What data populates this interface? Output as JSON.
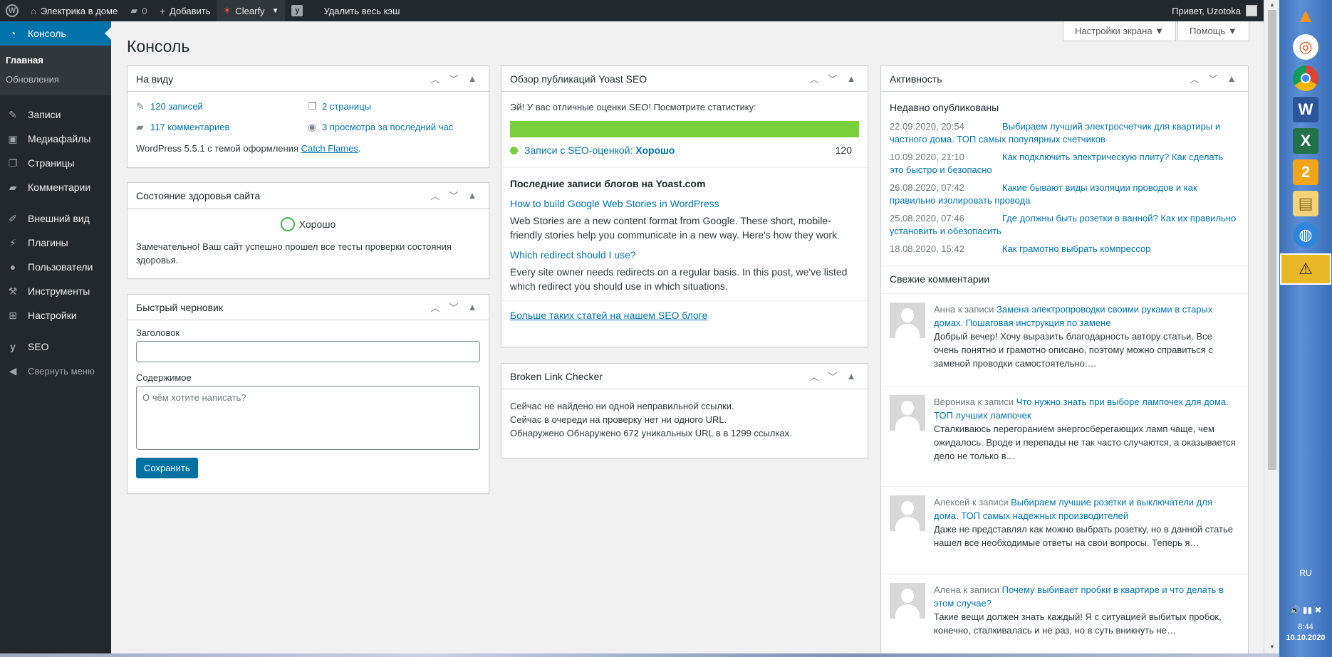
{
  "adminbar": {
    "site_name": "Электрика в доме",
    "comments_count": "0",
    "add_new": "Добавить",
    "clearfy": "Clearfy",
    "clear_cache": "Удалить весь кэш",
    "greeting": "Привет, Uzotoka"
  },
  "sidebar": {
    "dashboard": "Консоль",
    "home": "Главная",
    "updates": "Обновления",
    "posts": "Записи",
    "media": "Медиафайлы",
    "pages": "Страницы",
    "comments": "Комментарии",
    "appearance": "Внешний вид",
    "plugins": "Плагины",
    "users": "Пользователи",
    "tools": "Инструменты",
    "settings": "Настройки",
    "seo": "SEO",
    "collapse": "Свернуть меню"
  },
  "page": {
    "title": "Консоль",
    "screen_options": "Настройки экрана ▼",
    "help": "Помощь ▼"
  },
  "at_a_glance": {
    "title": "На виду",
    "posts": "120 записей",
    "pages": "2 страницы",
    "comments": "117 комментариев",
    "views": "3 просмотра за последний час",
    "version_text": "WordPress 5.5.1 с темой оформления ",
    "theme": "Catch Flames",
    "period": "."
  },
  "site_health": {
    "title": "Состояние здоровья сайта",
    "status": "Хорошо",
    "message": "Замечательно! Ваш сайт успешно прошел все тесты проверки состояния здоровья."
  },
  "quick_draft": {
    "title": "Быстрый черновик",
    "title_label": "Заголовок",
    "content_label": "Содержимое",
    "content_placeholder": "О чём хотите написать?",
    "save": "Сохранить"
  },
  "yoast": {
    "title": "Обзор публикаций Yoast SEO",
    "intro": "Эй! У вас отличные оценки SEO! Посмотрите статистику:",
    "score_label": "Записи с SEO-оценкой: ",
    "score_value": "Хорошо",
    "score_count": "120",
    "score_fraction": 1.0,
    "bar_color": "#7ad03a",
    "feed_title": "Последние записи блогов на Yoast.com",
    "feed": [
      {
        "title": "How to build Google Web Stories in WordPress",
        "desc": "Web Stories are a new content format from Google. These short, mobile-friendly stories help you communicate in a new way. Here's how they work"
      },
      {
        "title": "Which redirect should I use?",
        "desc": "Every site owner needs redirects on a regular basis. In this post, we've listed which redirect you should use in which situations."
      }
    ],
    "more": "Больше таких статей на нашем SEO блоге"
  },
  "blc": {
    "title": "Broken Link Checker",
    "line1": "Сейчас не найдено ни одной неправильной ссылки.",
    "line2": "Сейчас в очереди на проверку нет ни одного URL.",
    "line3": "Обнаружено Обнаружено 672 уникальных URL в в 1299 ссылках."
  },
  "activity": {
    "title": "Активность",
    "recent_title": "Недавно опубликованы",
    "recent": [
      {
        "date": "22.09.2020, 20:54",
        "title": "Выбираем лучший электросчетчик для квартиры и частного дома. ТОП самых популярных счетчиков"
      },
      {
        "date": "10.09.2020, 21:10",
        "title": "Как подключить электрическую плиту? Как сделать это быстро и безопасно"
      },
      {
        "date": "26.08.2020, 07:42",
        "title": "Какие бывают виды изоляции проводов и как правильно изолировать провода"
      },
      {
        "date": "25.08.2020, 07:46",
        "title": "Где должны быть розетки в ванной? Как их правильно установить и обезопасить"
      },
      {
        "date": "18.08.2020, 15:42",
        "title": "Как грамотно выбрать компрессор"
      }
    ],
    "comments_title": "Свежие комментарии",
    "comments": [
      {
        "author": "Анна к записи ",
        "post": "Замена электропроводки своими руками в старых домах. Пошаговая инструкция по замене",
        "text": "Добрый вечер! Хочу выразить благодарность автору статьи. Все очень понятно и грамотно описано, поэтому можно справиться с заменой проводки самостоятельно.…"
      },
      {
        "author": "Вероника к записи ",
        "post": "Что нужно знать при выборе лампочек для дома. ТОП лучших лампочек",
        "text": "Сталкиваюсь перегоранием энергосберегающих ламп чаще, чем ожидалось. Вроде и перепады не так часто случаются, а оказывается дело не только в…"
      },
      {
        "author": "Алексей к записи ",
        "post": "Выбираем лучшие розетки и выключатели для дома. ТОП самых надежных производителей",
        "text": "Даже не представлял как можно выбрать розетку, но в данной статье нашел все необходимые ответы на свои вопросы. Теперь я…"
      },
      {
        "author": "Алена к записи ",
        "post": "Почему выбивает пробки в квартире и что делать в этом случае?",
        "text": "Такие вещи должен знать каждый! Я с ситуацией выбитых пробок, конечно, сталкивалась и не раз, но в суть вникнуть не…"
      }
    ]
  },
  "taskbar": {
    "lang": "RU",
    "time": "8:44",
    "date": "10.10.2020"
  }
}
